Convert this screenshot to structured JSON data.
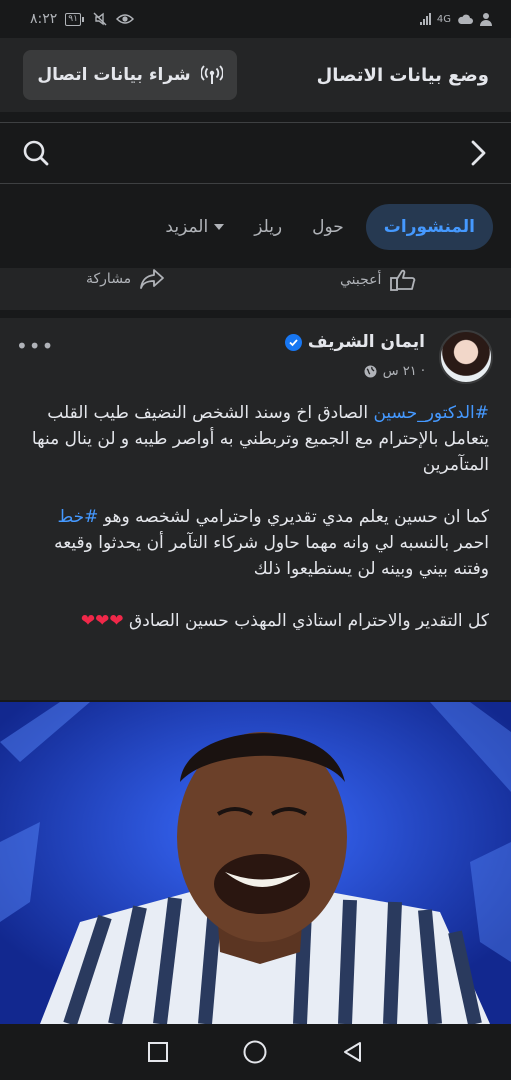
{
  "status_bar": {
    "time": "٨:٢٢",
    "battery": "٩١",
    "network": "4G",
    "icons": [
      "battery-icon",
      "mute-icon",
      "eye-icon",
      "signal-icon",
      "cloud-icon",
      "person-icon"
    ]
  },
  "data_bar": {
    "title": "وضع بيانات الاتصال",
    "buy_label": "شراء بيانات اتصال"
  },
  "tabs": {
    "items": [
      {
        "label": "المنشورات",
        "active": true
      },
      {
        "label": "حول",
        "active": false
      },
      {
        "label": "ريلز",
        "active": false
      },
      {
        "label": "المزيد",
        "active": false
      }
    ]
  },
  "prev_post_actions": {
    "like_label": "أعجبني",
    "share_label": "مشاركة"
  },
  "post": {
    "author": "ايمان الشريف",
    "time": "٢١ س ·",
    "p1_hashtag": "#الدكتور_حسين",
    "p1_text": " الصادق اخ وسند  الشخص النضيف طيب القلب يتعامل بالإحترام مع الجميع وتربطني به أواصر  طيبه و لن ينال منها المتآمرين",
    "p2_text_a": "كما ان حسين يعلم مدي تقديري واحترامي لشخصه وهو ",
    "p2_hashtag": "#خط",
    "p2_text_b": " احمر بالنسبه لي  وانه مهما حاول شركاء التآمر أن يحدثوا وقيعه وفتنه بيني وبينه لن يستطيعوا ذلك",
    "p3_text": "كل التقدير والاحترام استاذي المهذب حسين الصادق ",
    "p3_hearts": "❤❤❤"
  },
  "colors": {
    "background": "#18191a",
    "card": "#242526",
    "accent": "#4599ff",
    "verified": "#1877f2",
    "heart": "#f02849"
  }
}
